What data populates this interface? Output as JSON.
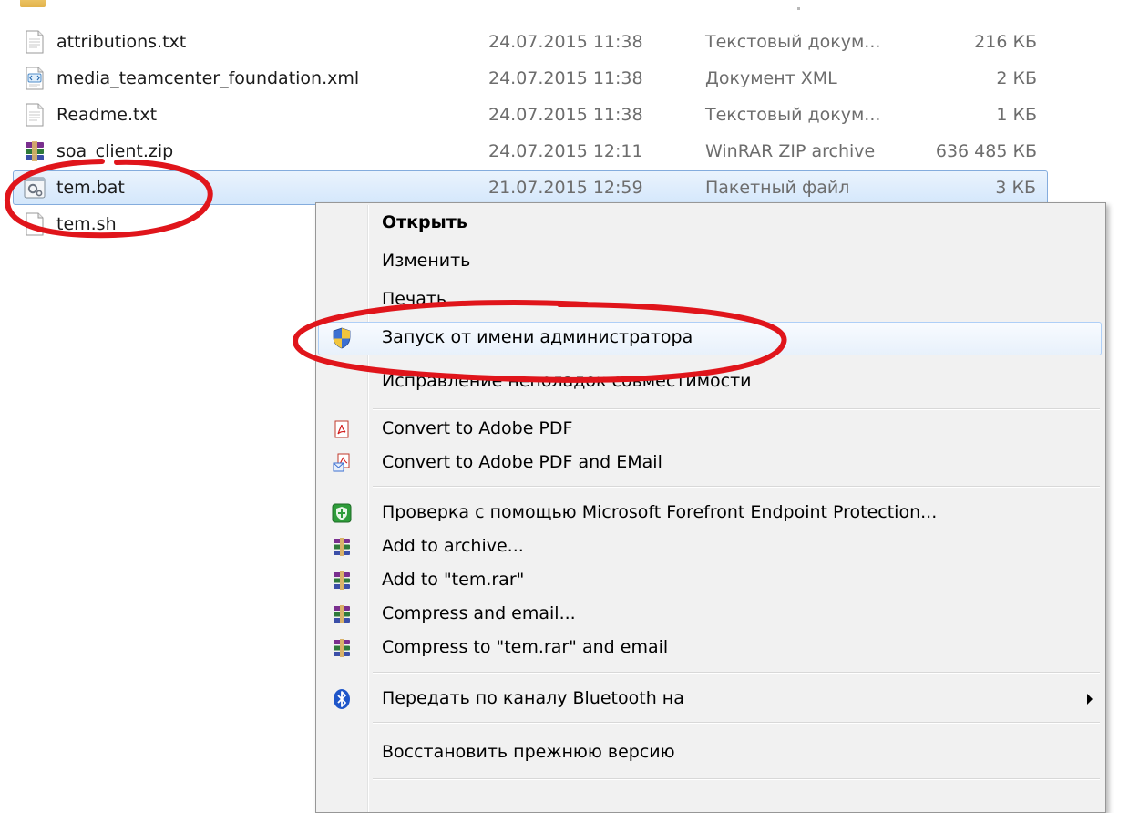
{
  "files": [
    {
      "name": "attributions.txt",
      "date": "24.07.2015 11:38",
      "type": "Текстовый докум...",
      "size": "216 КБ",
      "icon": "text-file-icon"
    },
    {
      "name": "media_teamcenter_foundation.xml",
      "date": "24.07.2015 11:38",
      "type": "Документ XML",
      "size": "2 КБ",
      "icon": "xml-file-icon"
    },
    {
      "name": "Readme.txt",
      "date": "24.07.2015 11:38",
      "type": "Текстовый докум...",
      "size": "1 КБ",
      "icon": "text-file-icon"
    },
    {
      "name": "soa_client.zip",
      "date": "24.07.2015 12:11",
      "type": "WinRAR ZIP archive",
      "size": "636 485 КБ",
      "icon": "winrar-archive-icon"
    },
    {
      "name": "tem.bat",
      "date": "21.07.2015 12:59",
      "type": "Пакетный файл",
      "size": "3 КБ",
      "icon": "batch-file-icon",
      "selected": true
    },
    {
      "name": "tem.sh",
      "date": "",
      "type": "",
      "size": "",
      "icon": "text-file-icon"
    }
  ],
  "context_menu": {
    "items": [
      {
        "label": "Открыть",
        "bold": true
      },
      {
        "label": "Изменить"
      },
      {
        "label": "Печать"
      },
      {
        "label": "Запуск от имени администратора",
        "icon": "uac-shield-icon",
        "highlighted": true
      },
      {
        "label": "Исправление неполадок совместимости"
      },
      {
        "label": "Convert to Adobe PDF",
        "icon": "adobe-pdf-icon"
      },
      {
        "label": "Convert to Adobe PDF and EMail",
        "icon": "adobe-pdf-email-icon"
      },
      {
        "label": "Проверка с помощью Microsoft Forefront Endpoint Protection...",
        "icon": "forefront-shield-icon"
      },
      {
        "label": "Add to archive...",
        "icon": "winrar-icon"
      },
      {
        "label": "Add to \"tem.rar\"",
        "icon": "winrar-icon"
      },
      {
        "label": "Compress and email...",
        "icon": "winrar-icon"
      },
      {
        "label": "Compress to \"tem.rar\" and email",
        "icon": "winrar-icon"
      },
      {
        "label": "Передать по каналу Bluetooth на",
        "icon": "bluetooth-icon",
        "submenu": true
      },
      {
        "label": "Восстановить прежнюю версию"
      }
    ]
  },
  "colors": {
    "annotation": "#e0151b",
    "selection_border": "#84acdd",
    "hover_border": "#aecff7",
    "menu_background": "#f1f1f1"
  }
}
